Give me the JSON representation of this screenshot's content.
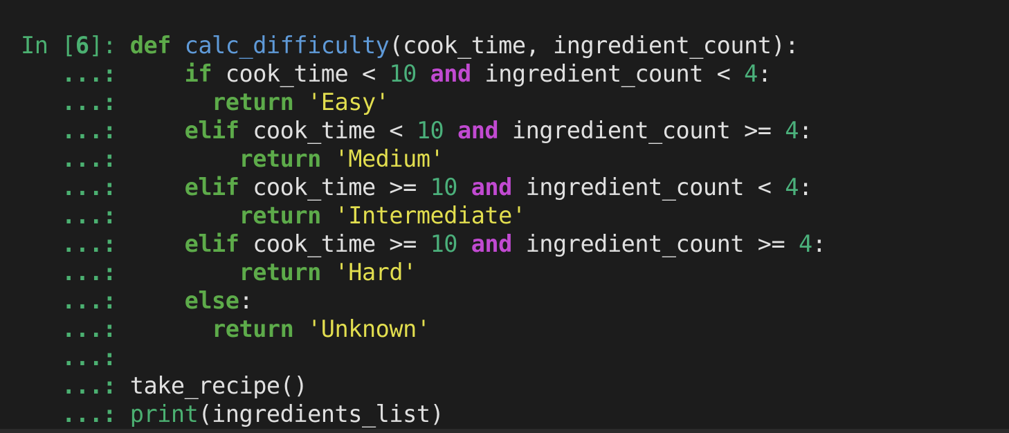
{
  "session": {
    "prompt_in": "In [",
    "prompt_number": "6",
    "prompt_close": "]: ",
    "continuation": "   ...: "
  },
  "code": {
    "l1_def": "def",
    "l1_fname": "calc_difficulty",
    "l1_args": "(cook_time, ingredient_count):",
    "l2_if": "if",
    "l2_a": " cook_time < ",
    "l2_n1": "10",
    "l2_and": "and",
    "l2_b": " ingredient_count < ",
    "l2_n2": "4",
    "l2_c": ":",
    "l3_return": "return",
    "l3_str": "'Easy'",
    "l4_elif": "elif",
    "l4_a": " cook_time < ",
    "l4_n1": "10",
    "l4_and": "and",
    "l4_b": " ingredient_count >= ",
    "l4_n2": "4",
    "l4_c": ":",
    "l5_return": "return",
    "l5_str": "'Medium'",
    "l6_elif": "elif",
    "l6_a": " cook_time >= ",
    "l6_n1": "10",
    "l6_and": "and",
    "l6_b": " ingredient_count < ",
    "l6_n2": "4",
    "l6_c": ":",
    "l7_return": "return",
    "l7_str": "'Intermediate'",
    "l8_elif": "elif",
    "l8_a": " cook_time >= ",
    "l8_n1": "10",
    "l8_and": "and",
    "l8_b": " ingredient_count >= ",
    "l8_n2": "4",
    "l8_c": ":",
    "l9_return": "return",
    "l9_str": "'Hard'",
    "l10_else": "else",
    "l10_c": ":",
    "l11_return": "return",
    "l11_str": "'Unknown'",
    "l13_call": "take_recipe()",
    "l14_print": "print",
    "l14_args": "(ingredients_list)"
  },
  "colors": {
    "background": "#1c1c1c",
    "prompt": "#4bb071",
    "keyword": "#5dab4a",
    "function_name": "#5f9ad8",
    "number": "#4bb07b",
    "string": "#e2de4f",
    "logical_operator": "#c14ad1",
    "plain_text": "#e0e0e0"
  }
}
